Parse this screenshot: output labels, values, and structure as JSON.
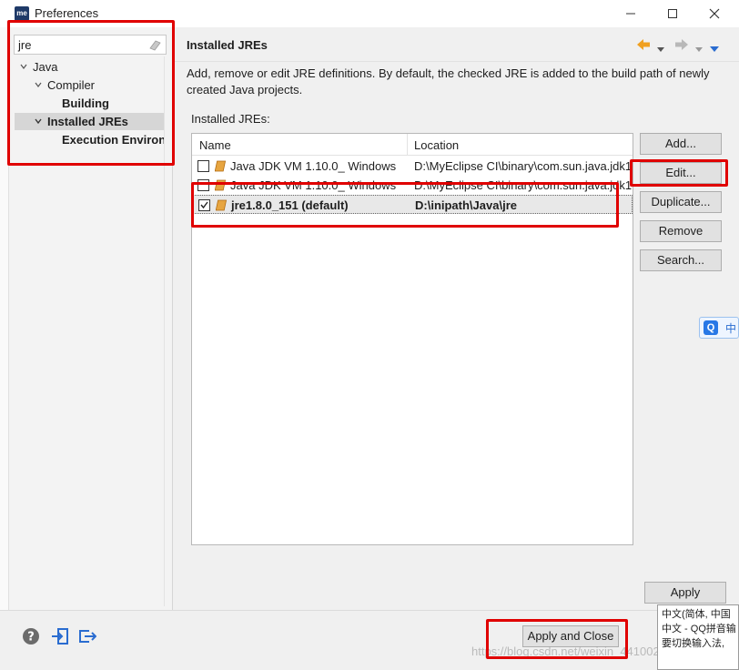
{
  "window": {
    "title": "Preferences",
    "logo": "me"
  },
  "filter": {
    "value": "jre"
  },
  "tree": {
    "items": [
      {
        "label": "Java"
      },
      {
        "label": "Compiler"
      },
      {
        "label": "Building"
      },
      {
        "label": "Installed JREs"
      },
      {
        "label": "Execution Environi"
      }
    ]
  },
  "page": {
    "title": "Installed JREs",
    "description": "Add, remove or edit JRE definitions. By default, the checked JRE is added to the build path of newly created Java projects.",
    "list_label": "Installed JREs:"
  },
  "table": {
    "columns": [
      "Name",
      "Location"
    ],
    "rows": [
      {
        "name": "Java JDK VM 1.10.0_ Windows",
        "location": "D:\\MyEclipse CI\\binary\\com.sun.java.jdk1",
        "checked": false
      },
      {
        "name": "Java JDK VM 1.10.0_ Windows",
        "location": "D:\\MyEclipse CI\\binary\\com.sun.java.jdk1",
        "checked": false
      },
      {
        "name": "jre1.8.0_151 (default)",
        "location": "D:\\inipath\\Java\\jre",
        "checked": true
      }
    ]
  },
  "buttons": {
    "add": "Add...",
    "edit": "Edit...",
    "duplicate": "Duplicate...",
    "remove": "Remove",
    "search": "Search...",
    "apply": "Apply",
    "apply_close": "Apply and Close"
  },
  "ime": {
    "chip": "中",
    "tooltip": [
      "中文(简体, 中国",
      "中文 - QQ拼音输",
      "要切换输入法,"
    ]
  },
  "watermark": "https://blog.csdn.net/weixin_44100234",
  "colors": {
    "annotation": "#e00000",
    "accent": "#1f3a68",
    "nav_arrow": "#f0a020"
  },
  "icons": [
    "help-icon",
    "import-icon",
    "export-icon",
    "back-arrow-icon",
    "forward-arrow-icon",
    "jre-library-icon"
  ]
}
